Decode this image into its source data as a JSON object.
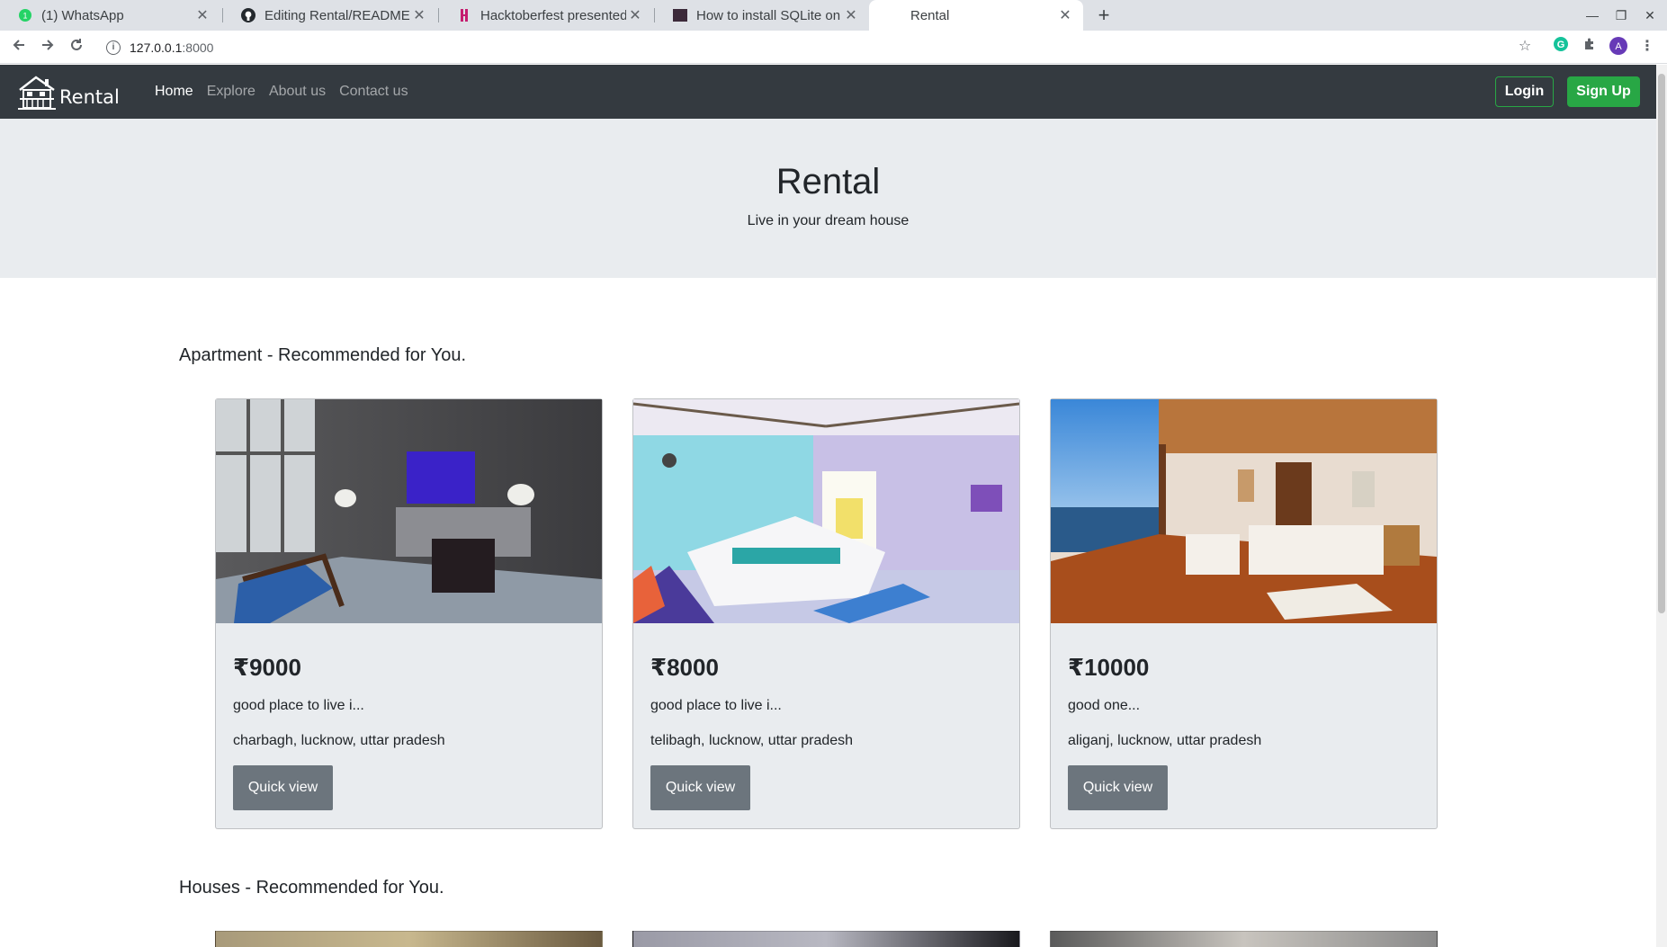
{
  "browser": {
    "tabs": [
      {
        "label": "(1) WhatsApp",
        "icon": "whatsapp-icon"
      },
      {
        "label": "Editing Rental/README.md",
        "icon": "github-icon"
      },
      {
        "label": "Hacktoberfest presented",
        "icon": "hacktoberfest-icon"
      },
      {
        "label": "How to install SQLite on Ubuntu",
        "icon": "page-icon"
      },
      {
        "label": "Rental",
        "icon": "page-icon"
      }
    ],
    "address_host": "127.0.0.1",
    "address_port": ":8000",
    "profile_initial": "A"
  },
  "navbar": {
    "brand": "Rental",
    "links": [
      {
        "label": "Home",
        "active": true
      },
      {
        "label": "Explore",
        "active": false
      },
      {
        "label": "About us",
        "active": false
      },
      {
        "label": "Contact us",
        "active": false
      }
    ],
    "login_label": "Login",
    "signup_label": "Sign Up"
  },
  "hero": {
    "title": "Rental",
    "subtitle": "Live in your dream house"
  },
  "sections": [
    {
      "title": "Apartment - Recommended for You.",
      "cards": [
        {
          "price": "₹9000",
          "description": "good place to live i...",
          "location": "charbagh, lucknow, uttar pradesh",
          "button": "Quick view"
        },
        {
          "price": "₹8000",
          "description": "good place to live i...",
          "location": "telibagh, lucknow, uttar pradesh",
          "button": "Quick view"
        },
        {
          "price": "₹10000",
          "description": "good one...",
          "location": "aliganj, lucknow, uttar pradesh",
          "button": "Quick view"
        }
      ]
    },
    {
      "title": "Houses - Recommended for You."
    }
  ],
  "colors": {
    "navbar_bg": "#343a40",
    "hero_bg": "#e9ecef",
    "success": "#28a745",
    "secondary": "#6c757d"
  }
}
